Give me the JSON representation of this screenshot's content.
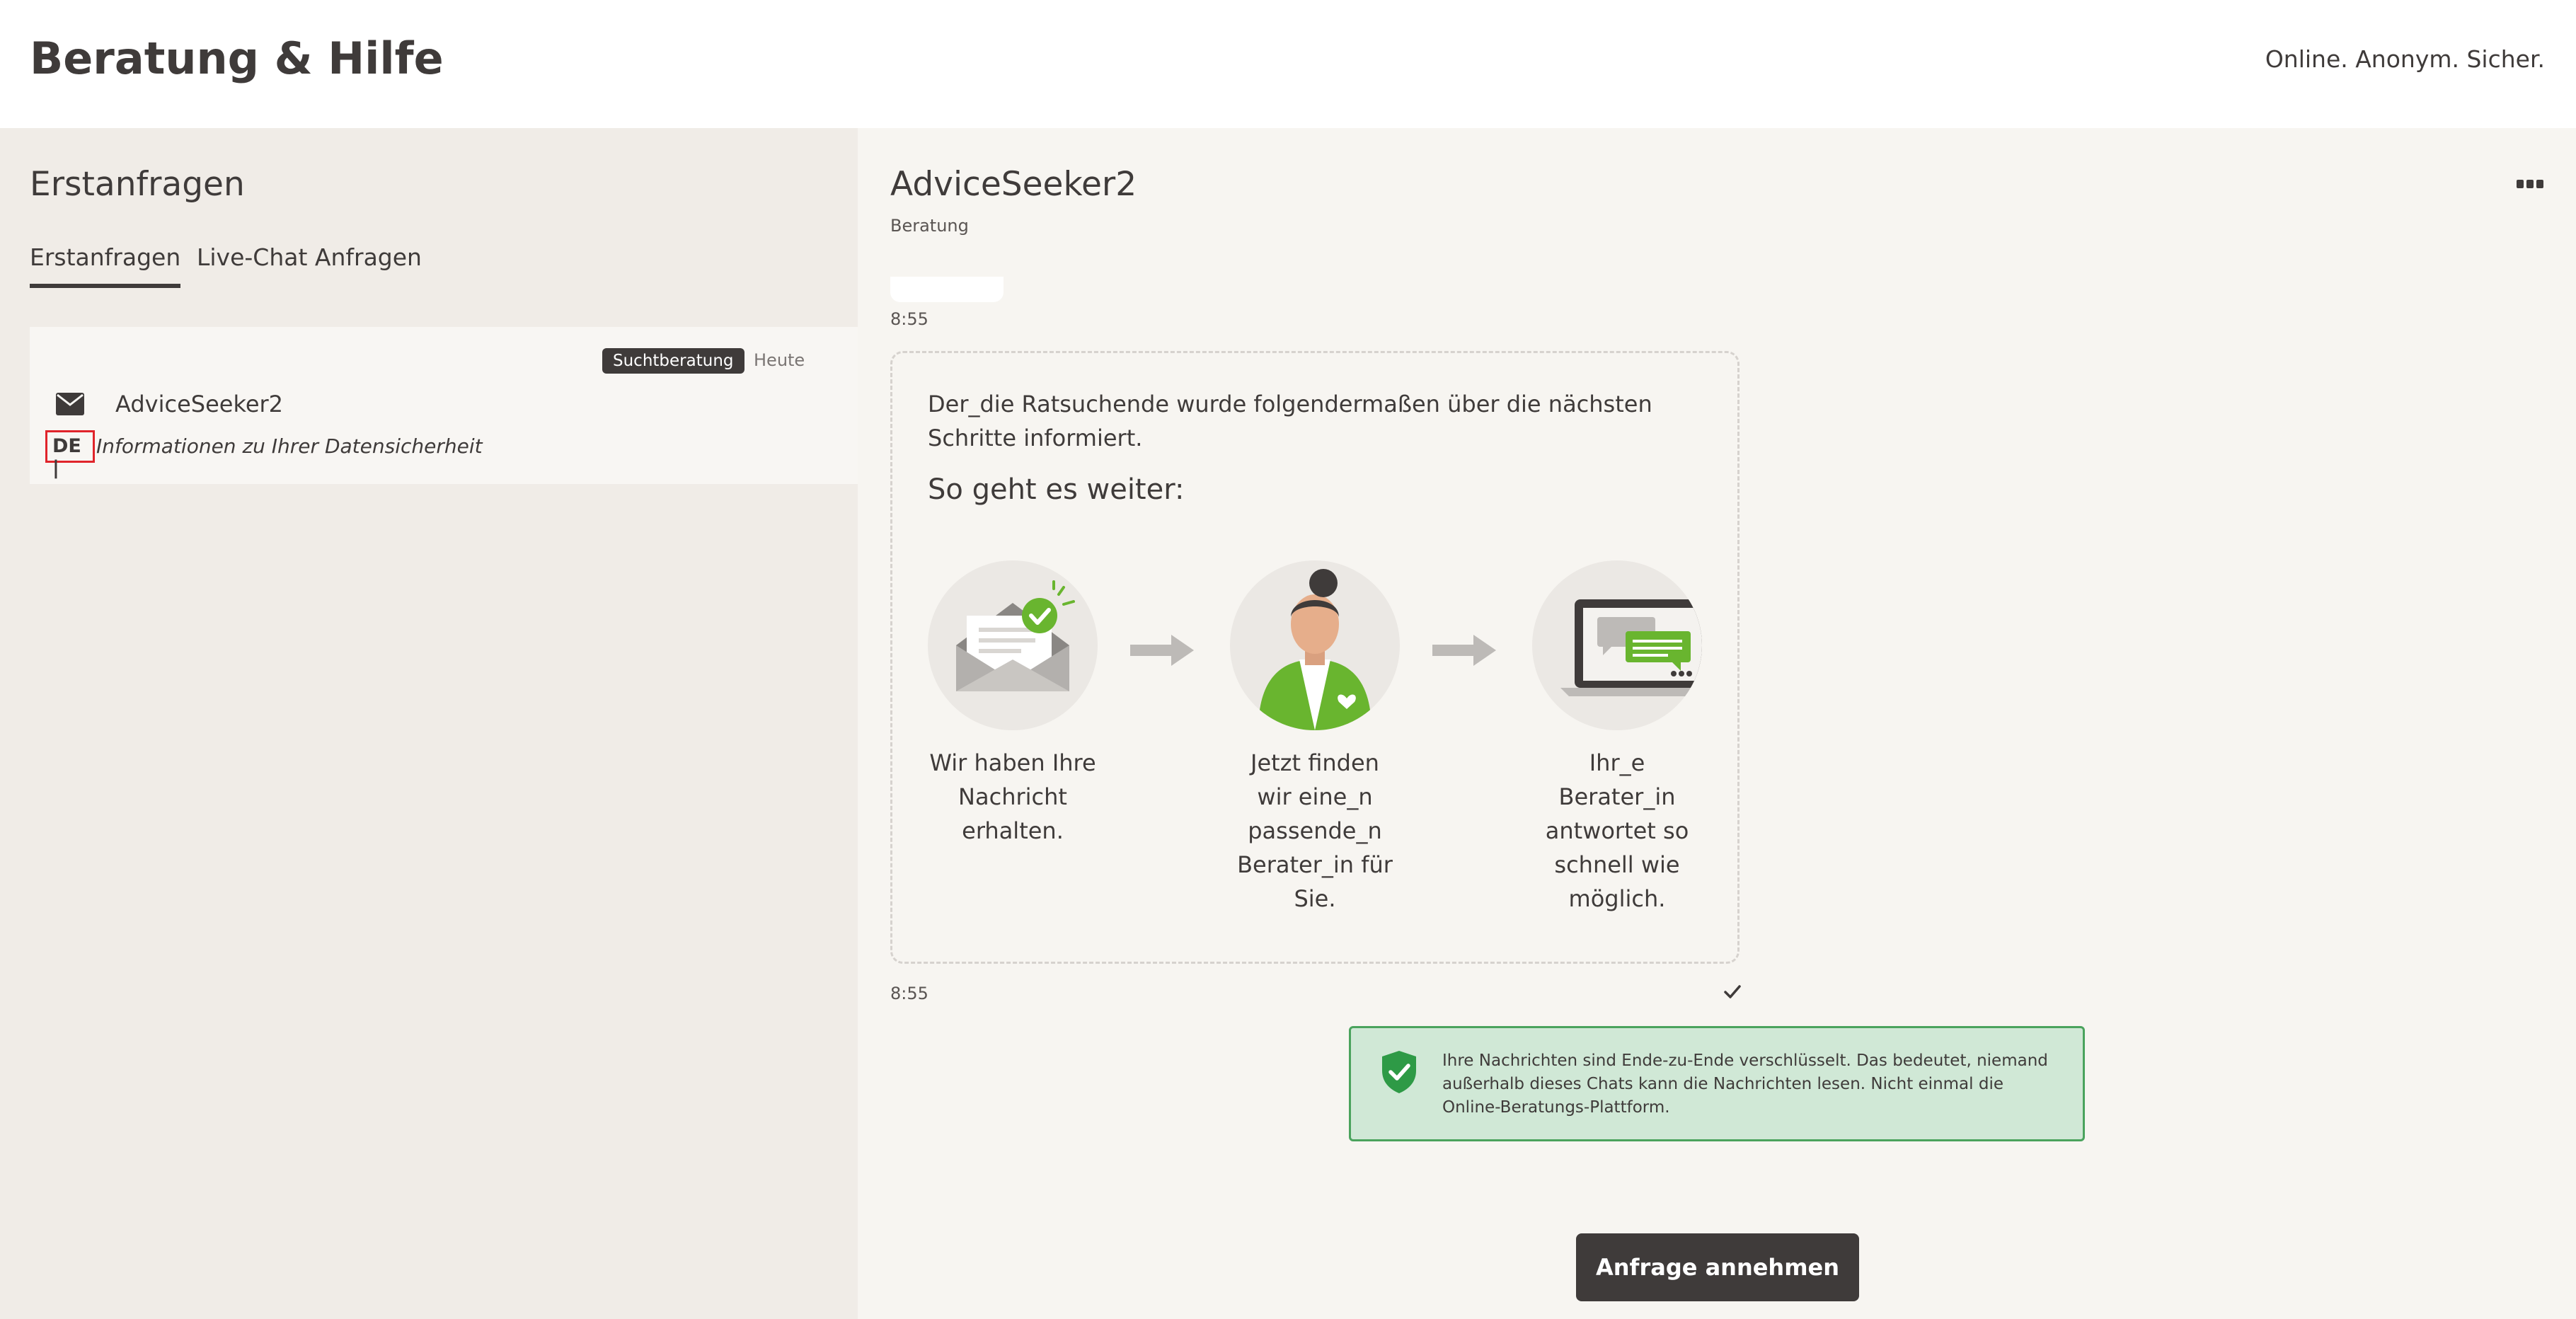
{
  "header": {
    "brand": "Beratung & Hilfe",
    "claim": "Online. Anonym. Sicher."
  },
  "sidebar": {
    "title": "Erstanfragen",
    "tabs": [
      {
        "label": "Erstanfragen",
        "active": true
      },
      {
        "label": "Live-Chat Anfragen",
        "active": false
      }
    ],
    "cards": [
      {
        "topic": "Suchtberatung",
        "date": "Heute",
        "name": "AdviceSeeker2",
        "language": "DE |",
        "subject": "Informationen zu Ihrer Datensicherheit",
        "icon": "envelope-icon"
      }
    ]
  },
  "session": {
    "name": "AdviceSeeker2",
    "subtitle": "Beratung",
    "messages": [
      {
        "time": "8:55"
      },
      {
        "time": "8:55",
        "intro": "Der_die Ratsuchende wurde folgendermaßen über die nächsten Schritte informiert.",
        "heading": "So geht es weiter:",
        "steps": [
          {
            "text": "Wir haben Ihre Nachricht erhalten.",
            "icon": "envelope-check-icon"
          },
          {
            "text": "Jetzt finden wir eine_n passende_n Berater_in für Sie.",
            "icon": "counselor-icon"
          },
          {
            "text": "Ihr_e Berater_in antwortet so schnell wie möglich.",
            "icon": "laptop-chat-icon"
          }
        ],
        "status": "sent"
      }
    ],
    "e2e_notice": "Ihre Nachrichten sind Ende-zu-Ende verschlüsselt. Das bedeutet, niemand außerhalb dieses Chats kann die Nachrichten lesen. Nicht einmal die Online-Beratungs-Plattform.",
    "accept_label": "Anfrage annehmen"
  },
  "colors": {
    "dark": "#3f3b3a",
    "accent_green": "#69b52f",
    "notice_bg": "#d0e8d6",
    "notice_border": "#4aa35d",
    "highlight_red": "#e0242b"
  }
}
